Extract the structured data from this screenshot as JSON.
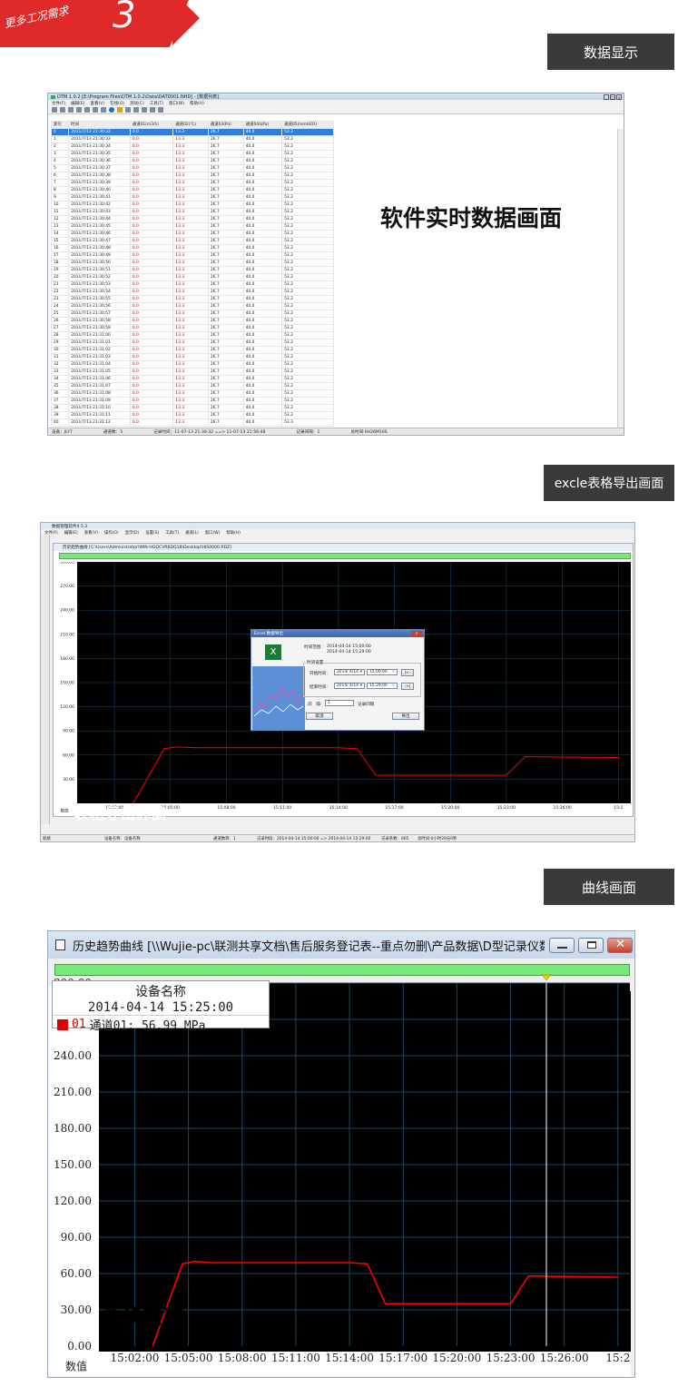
{
  "banner": {
    "text": "更多工况需求",
    "number": "3"
  },
  "sections": {
    "data_display": "数据显示",
    "excel_export": "excle表格导出画面",
    "curve": "曲线画面"
  },
  "w1": {
    "title": "DTM 1.0.2 [E:\\Program Files\\DTM 1.0.2\\Data\\DAT0001.NHD] - [数据列表]",
    "menu": [
      "文件(F)",
      "编辑(E)",
      "查看(V)",
      "在线(O)",
      "测试(C)",
      "工具(T)",
      "窗口(W)",
      "帮助(H)"
    ],
    "headers": [
      "索引",
      "时间",
      "通道01(m3/h)",
      "通道02(℃)",
      "通道03(Pa)",
      "通道04(kPa)",
      "通道05(mmH2O)"
    ],
    "rows": [
      [
        "0",
        "2011/7/13 21:30:32",
        "0.0",
        "13.3",
        "26.7",
        "40.0",
        "53.3"
      ],
      [
        "1",
        "2011/7/13 21:30:33",
        "0.0",
        "13.3",
        "26.7",
        "40.0",
        "53.3"
      ],
      [
        "2",
        "2011/7/13 21:30:34",
        "0.0",
        "13.3",
        "26.7",
        "40.0",
        "53.3"
      ],
      [
        "3",
        "2011/7/13 21:30:35",
        "0.0",
        "13.3",
        "26.7",
        "40.0",
        "53.3"
      ],
      [
        "4",
        "2011/7/13 21:30:36",
        "0.0",
        "13.3",
        "26.7",
        "40.0",
        "53.3"
      ],
      [
        "5",
        "2011/7/13 21:30:37",
        "0.0",
        "13.3",
        "26.7",
        "40.0",
        "53.3"
      ],
      [
        "6",
        "2011/7/13 21:30:38",
        "0.0",
        "13.3",
        "26.7",
        "40.0",
        "53.3"
      ],
      [
        "7",
        "2011/7/13 21:30:39",
        "0.0",
        "13.3",
        "26.7",
        "40.0",
        "53.3"
      ],
      [
        "8",
        "2011/7/13 21:30:40",
        "0.0",
        "13.3",
        "26.7",
        "40.0",
        "53.3"
      ],
      [
        "9",
        "2011/7/13 21:30:41",
        "0.0",
        "13.3",
        "26.7",
        "40.0",
        "53.3"
      ],
      [
        "10",
        "2011/7/13 21:30:42",
        "0.0",
        "13.3",
        "26.7",
        "40.0",
        "53.3"
      ],
      [
        "11",
        "2011/7/13 21:30:43",
        "0.0",
        "13.3",
        "26.7",
        "40.0",
        "53.3"
      ],
      [
        "12",
        "2011/7/13 21:30:44",
        "0.0",
        "13.3",
        "26.7",
        "40.0",
        "53.3"
      ],
      [
        "13",
        "2011/7/13 21:30:45",
        "0.0",
        "13.3",
        "26.7",
        "40.0",
        "53.3"
      ],
      [
        "14",
        "2011/7/13 21:30:46",
        "0.0",
        "13.3",
        "26.7",
        "40.0",
        "53.3"
      ],
      [
        "15",
        "2011/7/13 21:30:47",
        "0.0",
        "13.3",
        "26.7",
        "40.0",
        "53.3"
      ],
      [
        "16",
        "2011/7/13 21:30:48",
        "0.0",
        "13.3",
        "26.7",
        "40.0",
        "53.3"
      ],
      [
        "17",
        "2011/7/13 21:30:49",
        "0.0",
        "13.3",
        "26.7",
        "40.0",
        "53.3"
      ],
      [
        "18",
        "2011/7/13 21:30:50",
        "0.0",
        "13.3",
        "26.7",
        "40.0",
        "53.3"
      ],
      [
        "19",
        "2011/7/13 21:30:51",
        "0.0",
        "13.3",
        "26.7",
        "40.0",
        "53.3"
      ],
      [
        "20",
        "2011/7/13 21:30:52",
        "0.0",
        "13.3",
        "26.7",
        "40.0",
        "53.3"
      ],
      [
        "21",
        "2011/7/13 21:30:53",
        "0.0",
        "13.3",
        "26.7",
        "40.0",
        "53.3"
      ],
      [
        "22",
        "2011/7/13 21:30:54",
        "0.0",
        "13.3",
        "26.7",
        "40.0",
        "53.3"
      ],
      [
        "23",
        "2011/7/13 21:30:55",
        "0.0",
        "13.3",
        "26.7",
        "40.0",
        "53.3"
      ],
      [
        "24",
        "2011/7/13 21:30:56",
        "0.0",
        "13.3",
        "26.7",
        "40.0",
        "53.3"
      ],
      [
        "25",
        "2011/7/13 21:30:57",
        "0.0",
        "13.3",
        "26.7",
        "40.0",
        "53.3"
      ],
      [
        "26",
        "2011/7/13 21:30:58",
        "0.0",
        "13.3",
        "26.7",
        "40.0",
        "53.3"
      ],
      [
        "27",
        "2011/7/13 21:30:59",
        "0.0",
        "13.3",
        "26.7",
        "40.0",
        "53.3"
      ],
      [
        "28",
        "2011/7/13 21:31:00",
        "0.0",
        "13.3",
        "26.7",
        "40.0",
        "53.3"
      ],
      [
        "29",
        "2011/7/13 21:31:01",
        "0.0",
        "13.3",
        "26.7",
        "40.0",
        "53.3"
      ],
      [
        "30",
        "2011/7/13 21:31:02",
        "0.0",
        "13.3",
        "26.7",
        "40.0",
        "53.3"
      ],
      [
        "31",
        "2011/7/13 21:31:03",
        "0.0",
        "13.3",
        "26.7",
        "40.0",
        "53.3"
      ],
      [
        "32",
        "2011/7/13 21:31:04",
        "0.0",
        "13.3",
        "26.7",
        "40.0",
        "53.3"
      ],
      [
        "33",
        "2011/7/13 21:31:05",
        "0.0",
        "13.3",
        "26.7",
        "40.0",
        "53.3"
      ],
      [
        "34",
        "2011/7/13 21:31:06",
        "0.0",
        "13.3",
        "26.7",
        "40.0",
        "53.3"
      ],
      [
        "35",
        "2011/7/13 21:31:07",
        "0.0",
        "13.3",
        "26.7",
        "40.0",
        "53.3"
      ],
      [
        "36",
        "2011/7/13 21:31:08",
        "0.0",
        "13.3",
        "26.7",
        "40.0",
        "53.3"
      ],
      [
        "37",
        "2011/7/13 21:31:09",
        "0.0",
        "13.3",
        "26.7",
        "40.0",
        "53.3"
      ],
      [
        "38",
        "2011/7/13 21:31:10",
        "0.0",
        "13.3",
        "26.7",
        "40.0",
        "53.3"
      ],
      [
        "39",
        "2011/7/13 21:31:11",
        "0.0",
        "13.3",
        "26.7",
        "40.0",
        "53.3"
      ],
      [
        "40",
        "2011/7/13 21:31:12",
        "0.0",
        "13.3",
        "26.7",
        "40.0",
        "53.3"
      ]
    ],
    "overlay": "软件实时数据画面",
    "status": [
      "设备：JLY7",
      "通道数：5",
      "记录时间：11-07-13 21:30:32 ==> 11-07-13 21:56:48",
      "记录间隔：1",
      "总时间:0H26M16S"
    ]
  },
  "w2": {
    "title": "数据管理软件4.5.2",
    "menu": [
      "文件(F)",
      "编辑(E)",
      "查看(V)",
      "操作(O)",
      "显示(D)",
      "设置(S)",
      "工具(T)",
      "通道(L)",
      "窗口(W)",
      "帮助(H)"
    ],
    "inner_title": "历史趋势曲线 [C:\\Users\\Administrator\\WIN-HGQCVR6DQ18\\Desktop\\HIS0000.RDZ]",
    "y_ticks": [
      "300.00",
      "270.00",
      "240.00",
      "210.00",
      "180.00",
      "150.00",
      "120.00",
      "90.00",
      "60.00",
      "30.00"
    ],
    "x_ticks": [
      "15:02:00",
      "15:05:00",
      "15:08:00",
      "15:11:00",
      "15:14:00",
      "15:17:00",
      "15:20:00",
      "15:23:00",
      "15:26:00",
      "15:2"
    ],
    "x_label": "数值",
    "overlay": "表格导出界面",
    "status": [
      "就绪",
      "设备名称：设备名称",
      "通道数目：1",
      "记录时段：2014-04-14 15:00:00 => 2014-04-14 15:29:00",
      "记录条数：605",
      "总时间:0小时29分0秒"
    ],
    "dialog": {
      "title": "Excel 数据导出",
      "range_label": "时间范围:",
      "range_from": "2014-04-14 15:00:00",
      "range_to": "2014-04-14 15:29:00",
      "group_label": "时间设置",
      "start_label": "开始时间:",
      "start_date": "2014/ 4/14",
      "start_time": "15:00:00",
      "start_btn": "|<-",
      "end_label": "结束时间:",
      "end_date": "2014/ 4/14",
      "end_time": "15:29:00",
      "end_btn": "->|",
      "interval_label": "间　隔:",
      "interval_value": "1",
      "interval_unit": "记录间隔",
      "cancel": "取消",
      "export": "导出"
    }
  },
  "w3": {
    "title": "历史趋势曲线 [\\\\Wujie-pc\\联测共享文档\\售后服务登记表--重点勿删\\产品数据\\D型记录仪数据\\HIS...",
    "y_ticks": [
      "300.00",
      "270.00",
      "240.00",
      "210.00",
      "180.00",
      "150.00",
      "120.00",
      "90.00",
      "60.00",
      "30.00",
      "0.00"
    ],
    "x_ticks": [
      "15:02:00",
      "15:05:00",
      "15:08:00",
      "15:11:00",
      "15:14:00",
      "15:17:00",
      "15:20:00",
      "15:23:00",
      "15:26:00",
      "15:2"
    ],
    "x_label": "数值",
    "legend": {
      "device": "设备名称",
      "time": "2014-04-14 15:25:00",
      "index": "01",
      "channel": "通道01: 56.99 MPa"
    },
    "overlay": "曲线画面"
  },
  "chart_data": {
    "type": "line",
    "x": [
      "15:03:00",
      "15:04:40",
      "15:05:20",
      "15:06:20",
      "15:14:00",
      "15:15:00",
      "15:16:00",
      "15:23:00",
      "15:24:00",
      "15:29:00"
    ],
    "series": [
      {
        "values": [
          0,
          68,
          70,
          69,
          69,
          68,
          35,
          35,
          58,
          57
        ]
      }
    ],
    "ylim": [
      0,
      300
    ],
    "y_ticks": [
      30,
      60,
      90,
      120,
      150,
      180,
      210,
      240,
      270,
      300
    ],
    "grid": true,
    "colors": {
      "line": "#ff0000",
      "background": "#000000",
      "grid": "#1c4a66"
    }
  }
}
